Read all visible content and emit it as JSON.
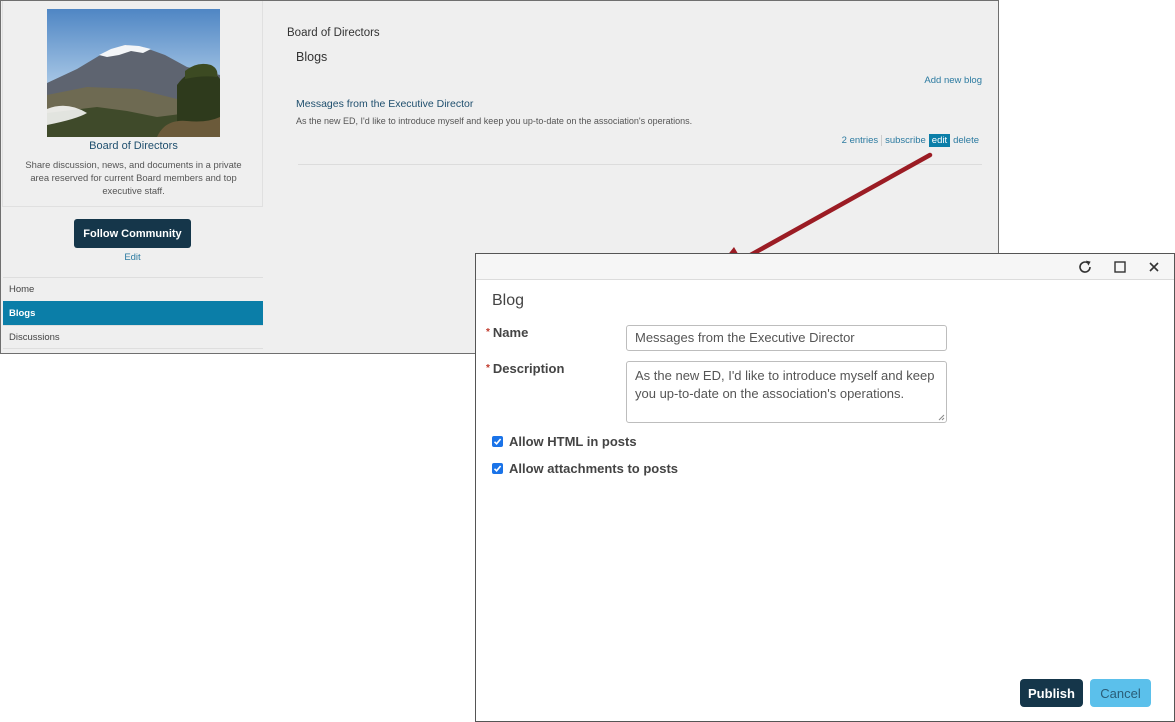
{
  "community": {
    "card_title": "Board of Directors",
    "card_description": "Share discussion, news, and documents in a private area reserved for current Board members and top executive staff.",
    "follow_label": "Follow Community",
    "edit_label": "Edit",
    "nav": [
      {
        "label": "Home"
      },
      {
        "label": "Blogs"
      },
      {
        "label": "Discussions"
      }
    ]
  },
  "main": {
    "title": "Board of Directors",
    "subtitle": "Blogs",
    "add_blog": "Add new blog",
    "blog": {
      "title": "Messages from the Executive Director",
      "description": "As the new ED, I'd like to introduce myself and keep you up-to-date on the association's operations.",
      "entries": "2 entries",
      "subscribe": "subscribe",
      "edit": "edit",
      "delete": "delete"
    }
  },
  "dialog": {
    "heading": "Blog",
    "required_mark": "*",
    "name_label": "Name",
    "name_value": "Messages from the Executive Director",
    "description_label": "Description",
    "description_value": "As the new ED, I'd like to introduce myself and keep you up-to-date on the association's operations.",
    "allow_html_label": "Allow HTML in posts",
    "allow_attachments_label": "Allow attachments to posts",
    "publish_label": "Publish",
    "cancel_label": "Cancel"
  },
  "colors": {
    "nav_active": "#0b7ea8",
    "primary_button": "#15364a",
    "cancel_button": "#5bc0eb",
    "arrow": "#9b1c24"
  }
}
